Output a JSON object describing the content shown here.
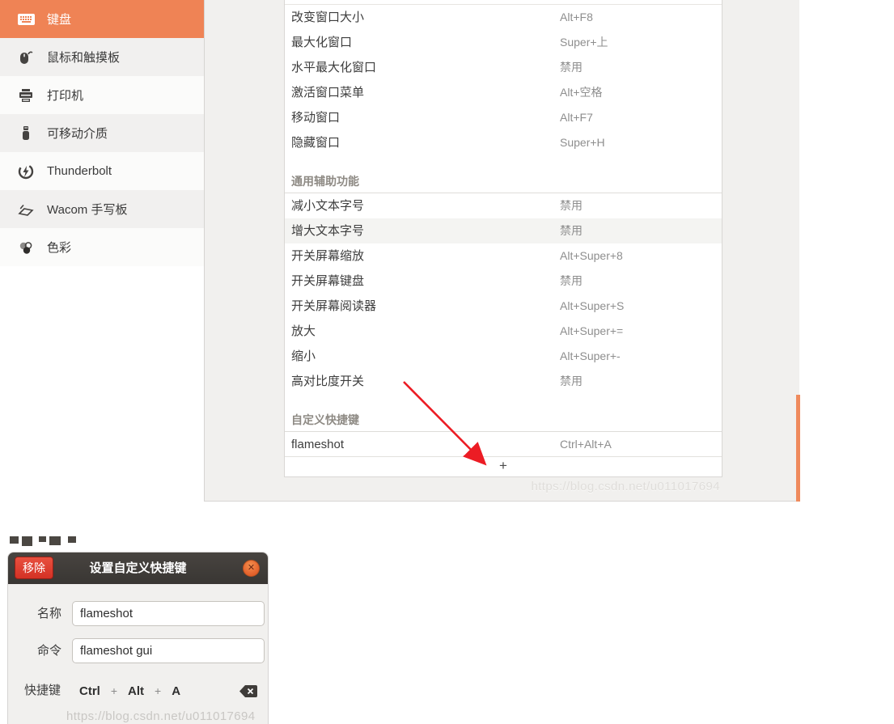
{
  "watermark": {
    "text": "https://blog.csdn.net/u011017694"
  },
  "sidebar": {
    "items": [
      {
        "label": "键盘",
        "icon": "keyboard-icon",
        "selected": true
      },
      {
        "label": "鼠标和触摸板",
        "icon": "mouse-icon",
        "selected": false
      },
      {
        "label": "打印机",
        "icon": "printer-icon",
        "selected": false
      },
      {
        "label": "可移动介质",
        "icon": "usb-drive-icon",
        "selected": false
      },
      {
        "label": "Thunderbolt",
        "icon": "thunderbolt-icon",
        "selected": false
      },
      {
        "label": "Wacom 手写板",
        "icon": "wacom-tablet-icon",
        "selected": false
      },
      {
        "label": "色彩",
        "icon": "color-icon",
        "selected": false
      }
    ]
  },
  "shortcuts": {
    "groups": [
      {
        "title": null,
        "rows": [
          {
            "label": "改变窗口大小",
            "value": "Alt+F8"
          },
          {
            "label": "最大化窗口",
            "value": "Super+上"
          },
          {
            "label": "水平最大化窗口",
            "value": "禁用"
          },
          {
            "label": "激活窗口菜单",
            "value": "Alt+空格"
          },
          {
            "label": "移动窗口",
            "value": "Alt+F7"
          },
          {
            "label": "隐藏窗口",
            "value": "Super+H"
          }
        ]
      },
      {
        "title": "通用辅助功能",
        "rows": [
          {
            "label": "减小文本字号",
            "value": "禁用"
          },
          {
            "label": "增大文本字号",
            "value": "禁用",
            "highlighted": true
          },
          {
            "label": "开关屏幕缩放",
            "value": "Alt+Super+8"
          },
          {
            "label": "开关屏幕键盘",
            "value": "禁用"
          },
          {
            "label": "开关屏幕阅读器",
            "value": "Alt+Super+S"
          },
          {
            "label": "放大",
            "value": "Alt+Super+="
          },
          {
            "label": "缩小",
            "value": "Alt+Super+-"
          },
          {
            "label": "高对比度开关",
            "value": "禁用"
          }
        ]
      },
      {
        "title": "自定义快捷键",
        "rows": [
          {
            "label": "flameshot",
            "value": "Ctrl+Alt+A"
          }
        ]
      }
    ],
    "add_button_label": "+"
  },
  "dialog": {
    "title": "设置自定义快捷键",
    "remove_button": "移除",
    "close_icon": "close-icon",
    "fields": [
      {
        "label": "名称",
        "value": "flameshot"
      },
      {
        "label": "命令",
        "value": "flameshot gui"
      }
    ],
    "shortcut": {
      "label": "快捷键",
      "keys": [
        "Ctrl",
        "+",
        "Alt",
        "+",
        "A"
      ],
      "backspace_icon": "backspace-icon"
    }
  },
  "colors": {
    "accent_orange": "#EF8355",
    "titlebar_dark": "#3C3936",
    "remove_red": "#DE372B",
    "close_orange": "#E8672F",
    "arrow_red": "#EC1C24"
  }
}
